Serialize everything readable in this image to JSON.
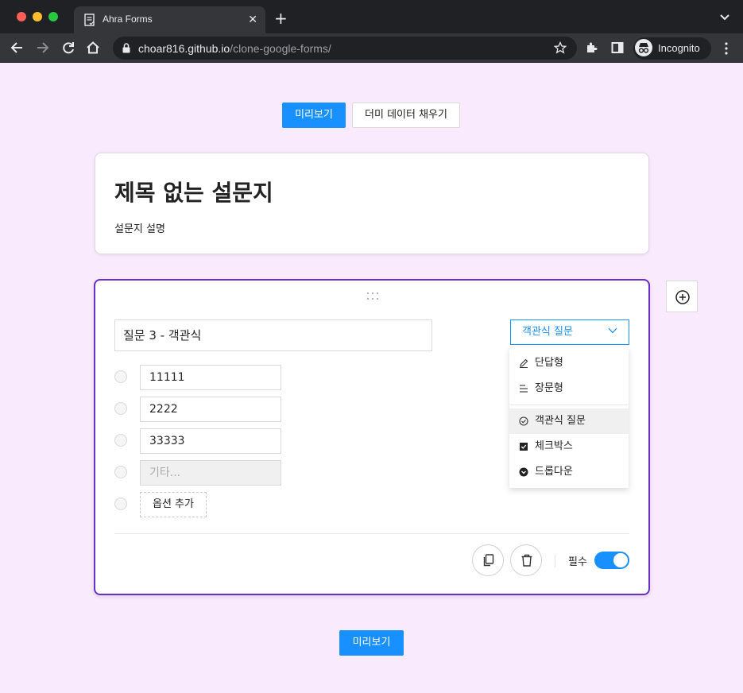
{
  "browser": {
    "tab_title": "Ahra Forms",
    "url_host": "choar816.github.io",
    "url_path": "/clone-google-forms/",
    "profile_label": "Incognito"
  },
  "top_actions": {
    "preview_label": "미리보기",
    "dummy_label": "더미 데이터 채우기"
  },
  "form": {
    "title": "제목 없는 설문지",
    "description": "설문지 설명"
  },
  "question": {
    "title": "질문 3 - 객관식",
    "type_selected": "객관식 질문",
    "options": [
      "11111",
      "2222",
      "33333"
    ],
    "etc_placeholder": "기타...",
    "add_option_label": "옵션 추가",
    "required_label": "필수",
    "required_on": true
  },
  "type_menu": {
    "items": [
      {
        "label": "단답형",
        "icon": "pencil-icon"
      },
      {
        "label": "장문형",
        "icon": "paragraph-lines-icon"
      },
      {
        "label": "객관식 질문",
        "icon": "check-circle-icon",
        "selected": true
      },
      {
        "label": "체크박스",
        "icon": "checkbox-icon"
      },
      {
        "label": "드롭다운",
        "icon": "dropdown-circle-icon"
      }
    ]
  },
  "bottom_actions": {
    "preview_label": "미리보기"
  },
  "colors": {
    "page_bg": "#f9ebfd",
    "accent": "#1890ff",
    "card_active_border": "#6a2fc7"
  }
}
